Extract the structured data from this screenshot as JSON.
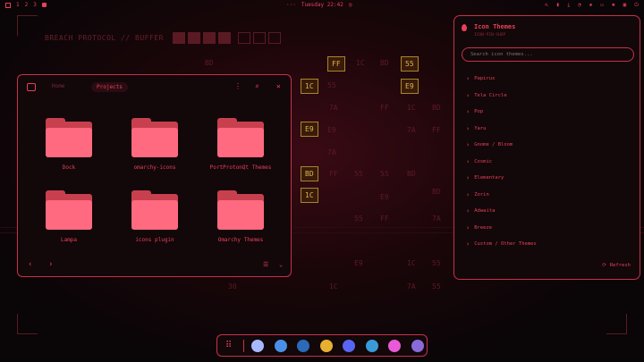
{
  "topbar": {
    "workspaces": [
      "1",
      "2",
      "3"
    ],
    "center_dots": "···",
    "clock": "Tuesday 22:42",
    "right_icons": [
      "download-icon",
      "wifi-icon",
      "volume-icon",
      "battery-icon",
      "bluetooth-icon",
      "monitor-icon"
    ]
  },
  "breach": {
    "title": "BREACH PROTOCOL // BUFFER"
  },
  "matrix": [
    {
      "t": "FF",
      "box": true
    },
    {
      "t": "1C",
      "box": false
    },
    {
      "t": "BD",
      "box": false
    },
    {
      "t": "55",
      "box": true
    },
    {
      "t": "BD",
      "box": false
    },
    {
      "t": "1C",
      "box": true
    },
    {
      "t": "55",
      "box": false
    },
    {
      "t": "E9",
      "box": true
    },
    {
      "t": "7A",
      "box": false
    },
    {
      "t": "FF",
      "box": false
    },
    {
      "t": "1C",
      "box": false
    },
    {
      "t": "BD",
      "box": false
    },
    {
      "t": "E9",
      "box": true
    },
    {
      "t": "E9",
      "box": false
    },
    {
      "t": "7A",
      "box": false
    },
    {
      "t": "FF",
      "box": false
    },
    {
      "t": "7A",
      "box": false
    },
    {
      "t": "BD",
      "box": true
    },
    {
      "t": "FF",
      "box": false
    },
    {
      "t": "55",
      "box": false
    },
    {
      "t": "55",
      "box": false
    },
    {
      "t": "BD",
      "box": false
    },
    {
      "t": "1C",
      "box": true
    },
    {
      "t": "BD",
      "box": false
    },
    {
      "t": "E9",
      "box": false
    },
    {
      "t": "55",
      "box": false
    },
    {
      "t": "FF",
      "box": false
    },
    {
      "t": "7A",
      "box": false
    },
    {
      "t": "BD",
      "box": false
    },
    {
      "t": "E9",
      "box": false
    },
    {
      "t": "1C",
      "box": false
    },
    {
      "t": "55",
      "box": false
    },
    {
      "t": "30",
      "box": false
    },
    {
      "t": "1C",
      "box": false
    },
    {
      "t": "7A",
      "box": false
    },
    {
      "t": "55",
      "box": false
    }
  ],
  "files": {
    "crumb_home": "Home",
    "crumb_current": "Projects",
    "folders": [
      {
        "name": "Dock"
      },
      {
        "name": "omarchy-icons"
      },
      {
        "name": "PortProtonQt Themes"
      },
      {
        "name": "Lampa"
      },
      {
        "name": "icons plugin"
      },
      {
        "name": "Omarchy Themes"
      }
    ]
  },
  "panel": {
    "title": "Icon Themes",
    "subtitle": "ICON-PIN-SHOP",
    "search_placeholder": "Search icon themes...",
    "items": [
      {
        "label": "Papirus"
      },
      {
        "label": "Tela Circle"
      },
      {
        "label": "Pop"
      },
      {
        "label": "Yaru"
      },
      {
        "label": "Gnome / Bloom"
      },
      {
        "label": "Cosmic"
      },
      {
        "label": "Elementary"
      },
      {
        "label": "Zorin"
      },
      {
        "label": "Adwaita"
      },
      {
        "label": "Breeze"
      },
      {
        "label": "Custom / Other Themes"
      }
    ],
    "refresh_label": "Refresh"
  },
  "dock": {
    "apps": [
      {
        "name": "ghost-app-icon",
        "color": "#a8b8ff"
      },
      {
        "name": "files-app-icon",
        "color": "#4a90e8"
      },
      {
        "name": "steam-app-icon",
        "color": "#2a6ab8"
      },
      {
        "name": "chrome-app-icon",
        "color": "#e8b030"
      },
      {
        "name": "discord-app-icon",
        "color": "#5865f2"
      },
      {
        "name": "browser-app-icon",
        "color": "#3a9ad8"
      },
      {
        "name": "color-picker-app-icon",
        "color": "#e85ad8"
      },
      {
        "name": "inkscape-app-icon",
        "color": "#8a6ad8"
      }
    ]
  }
}
